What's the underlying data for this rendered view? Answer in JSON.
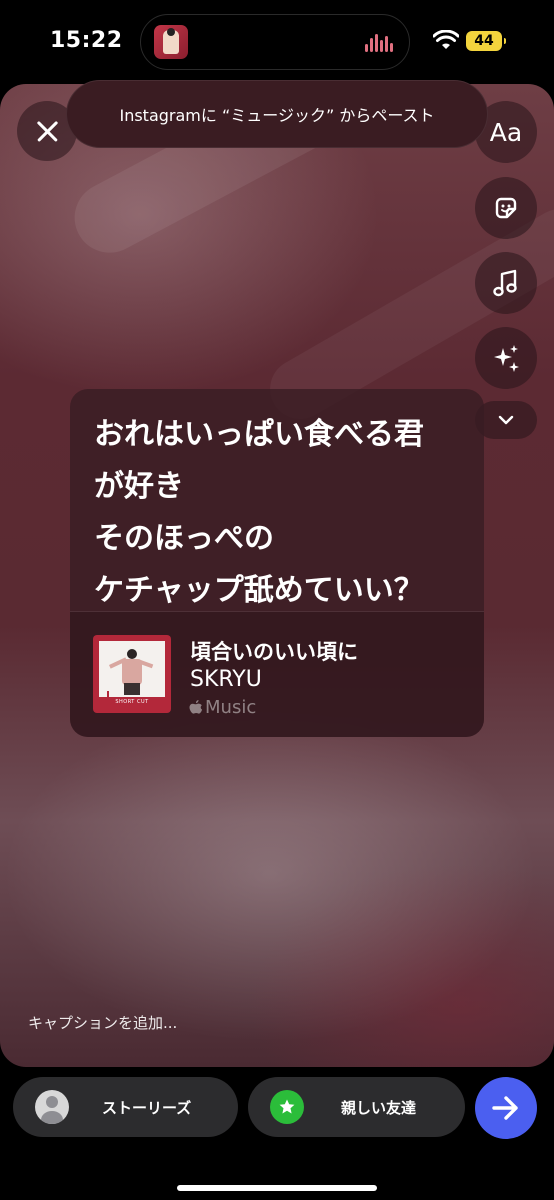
{
  "status_bar": {
    "time": "15:22",
    "battery": "44",
    "battery_color": "#f3d43d"
  },
  "banner": {
    "text": "Instagramに “ミュージック” からペースト"
  },
  "tools": {
    "text_label": "Aa",
    "icons": [
      "close-icon",
      "sticker-icon",
      "music-note-icon",
      "sparkles-icon",
      "chevron-down-icon"
    ]
  },
  "lyrics": {
    "text": "おれはいっぱい食べる君\nが好き\nそのほっぺの\nケチャップ舐めていい？"
  },
  "track": {
    "title": "頃合いのいい頃に",
    "artist": "SKRYU",
    "service": "Music",
    "album_caption": "SHORT CUT"
  },
  "caption": {
    "placeholder": "キャプションを追加..."
  },
  "share": {
    "stories_label": "ストーリーズ",
    "close_friends_label": "親しい友達",
    "send_color": "#4b5ff0",
    "close_friends_color": "#2bbd3a"
  }
}
